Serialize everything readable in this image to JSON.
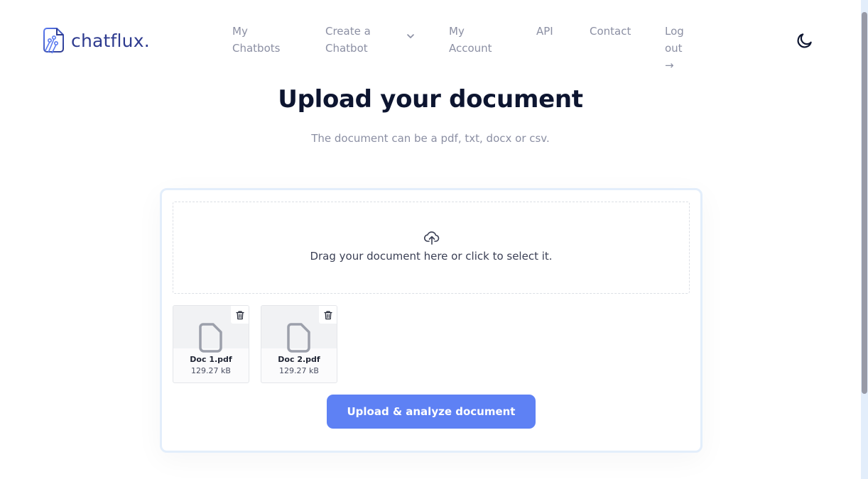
{
  "app": {
    "brand": "chatflux.",
    "brand_color": "#2e3b8f"
  },
  "nav": {
    "items": [
      {
        "line1": "My",
        "line2": "Chatbots"
      },
      {
        "line1": "Create a",
        "line2": "Chatbot",
        "has_dropdown": true,
        "dropdown_icon": "chevron-down-icon"
      },
      {
        "line1": "My",
        "line2": "Account"
      },
      {
        "line1": "API",
        "line2": ""
      },
      {
        "line1": "Contact",
        "line2": ""
      },
      {
        "line1": "Log out",
        "line2": "→"
      }
    ],
    "theme_toggle_icon": "moon-icon"
  },
  "main": {
    "title": "Upload your document",
    "subtitle": "The document can be a pdf, txt, docx or csv.",
    "dropzone": {
      "icon": "cloud-upload-icon",
      "text": "Drag your document here or click to select it."
    },
    "files": [
      {
        "name": "Doc 1.pdf",
        "size": "129.27 kB",
        "icon": "file-icon",
        "delete_icon": "trash-icon"
      },
      {
        "name": "Doc 2.pdf",
        "size": "129.27 kB",
        "icon": "file-icon",
        "delete_icon": "trash-icon"
      }
    ],
    "upload_button": "Upload & analyze document",
    "accent_color": "#5e81f4"
  }
}
